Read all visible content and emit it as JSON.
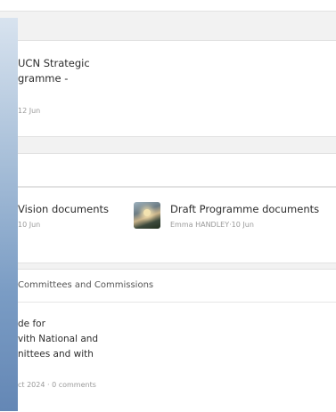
{
  "posts": [
    {
      "title_lines": [
        "UCN Strategic",
        "gramme -"
      ],
      "meta": "12 Jun"
    }
  ],
  "documents": {
    "items": [
      {
        "title": "Vision documents",
        "meta": "10 Jun"
      },
      {
        "title": "Draft Programme documents",
        "meta": "Emma HANDLEY·10 Jun",
        "thumbnail": "landscape-sunset-icon"
      }
    ]
  },
  "committees": {
    "header": "Committees and Commissions",
    "post_lines": [
      "de for",
      "vith National and",
      "nittees and with"
    ],
    "meta": "ct 2024 · 0 comments"
  },
  "colors": {
    "sidebar_top": "#d8e3ef",
    "sidebar_bottom": "#6487b5",
    "card": "#ffffff",
    "background": "#f2f2f2"
  }
}
